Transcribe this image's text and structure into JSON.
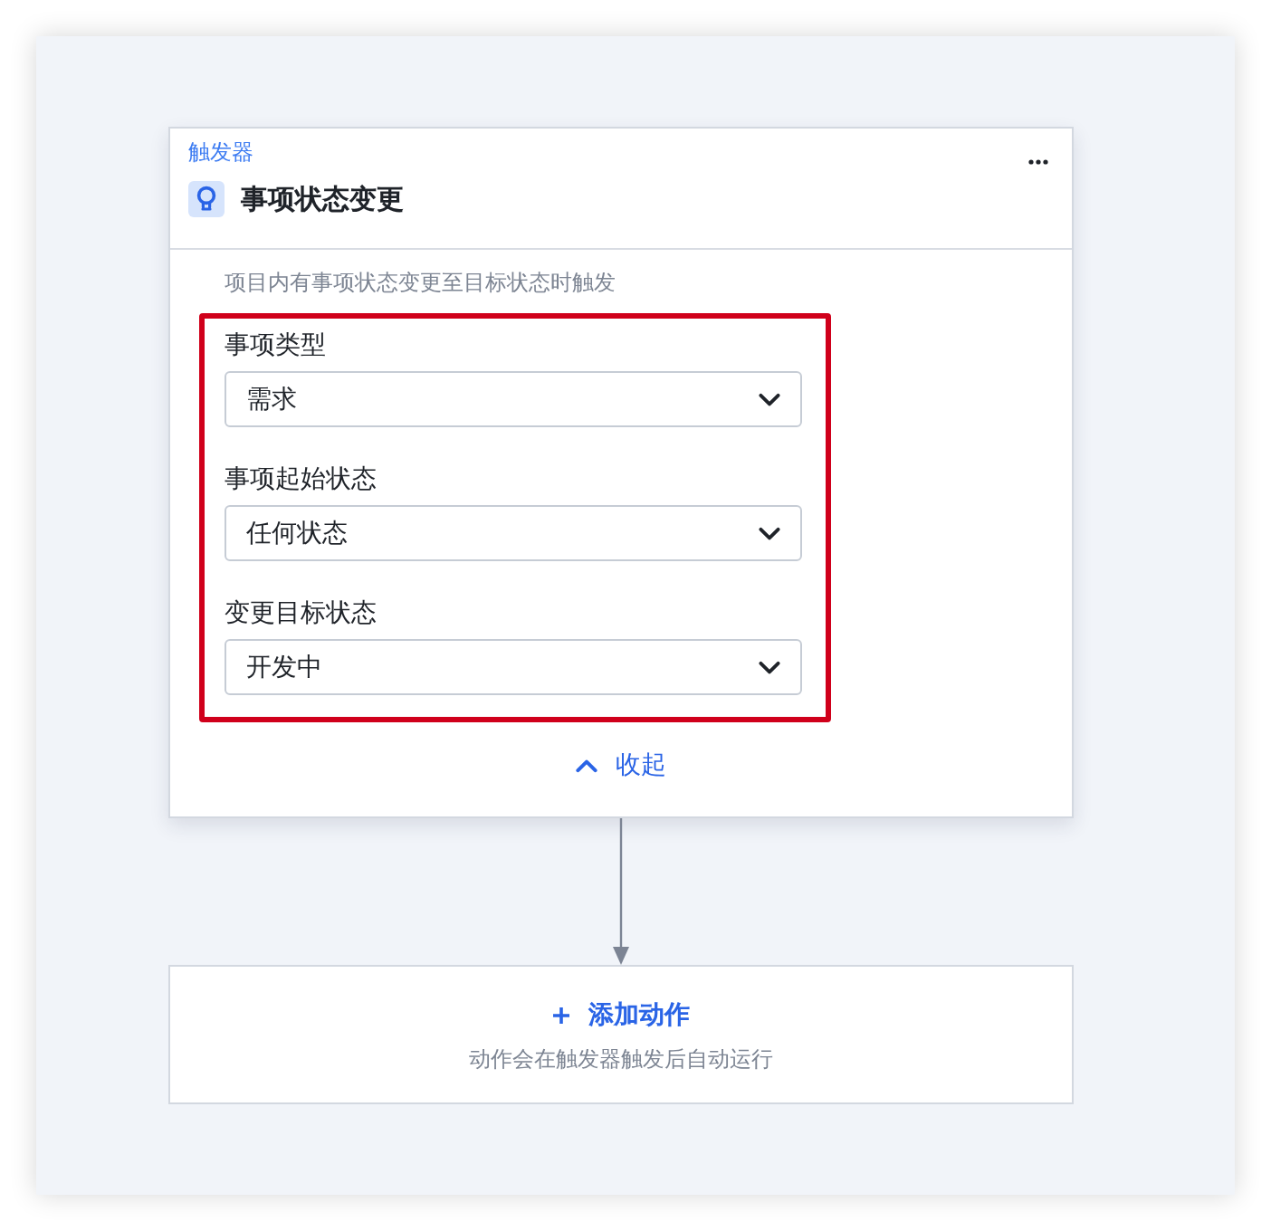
{
  "trigger_card": {
    "category": "触发器",
    "title": "事项状态变更",
    "description": "项目内有事项状态变更至目标状态时触发",
    "expanded": true,
    "highlighted": true,
    "fields": [
      {
        "label": "事项类型",
        "value": "需求"
      },
      {
        "label": "事项起始状态",
        "value": "任何状态"
      },
      {
        "label": "变更目标状态",
        "value": "开发中"
      }
    ],
    "collapse_label": "收起"
  },
  "action_card": {
    "button": "添加动作",
    "hint": "动作会在触发器触发后自动运行"
  }
}
